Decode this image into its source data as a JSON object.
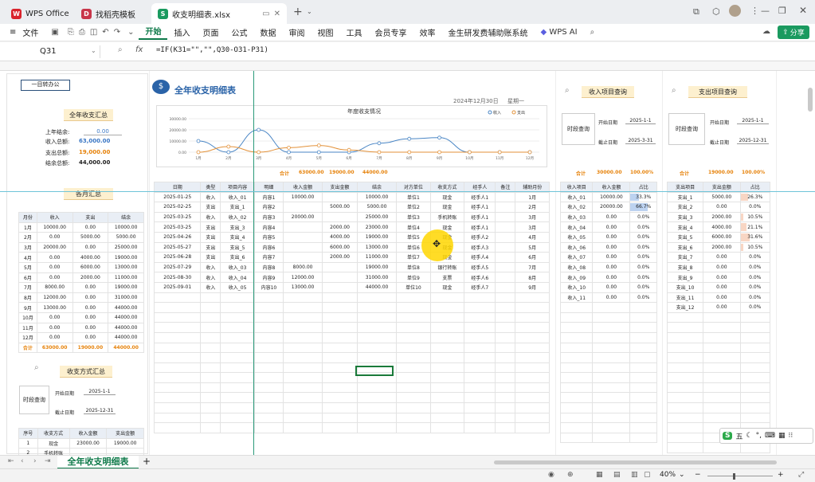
{
  "tabs": [
    {
      "label": "WPS Office"
    },
    {
      "label": "找稻壳模板"
    },
    {
      "label": "收支明细表.xlsx"
    }
  ],
  "menu": {
    "file": "文件",
    "items": [
      "开始",
      "插入",
      "页面",
      "公式",
      "数据",
      "审阅",
      "视图",
      "工具",
      "会员专享",
      "效率",
      "金生研发费辅助账系统"
    ],
    "wps_ai": "WPS AI",
    "share": "分享"
  },
  "formula_bar": {
    "cell_ref": "Q31",
    "fx": "fx",
    "formula": "=IF(K31=\"\",\"\",Q30-O31-P31)"
  },
  "left_panel": {
    "button": "一目转办公",
    "annual_title": "全年收支汇总",
    "summary": [
      {
        "label": "上年结余:",
        "value": "0.00"
      },
      {
        "label": "收入总额:",
        "value": "63,000.00"
      },
      {
        "label": "支出总额:",
        "value": "19,000.00"
      },
      {
        "label": "结余总额:",
        "value": "44,000.00"
      }
    ],
    "monthly_title": "各月汇总",
    "monthly_headers": [
      "月份",
      "收入",
      "支出",
      "结余"
    ],
    "monthly_rows": [
      [
        "1月",
        "10000.00",
        "0.00",
        "10000.00"
      ],
      [
        "2月",
        "0.00",
        "5000.00",
        "5000.00"
      ],
      [
        "3月",
        "20000.00",
        "0.00",
        "25000.00"
      ],
      [
        "4月",
        "0.00",
        "4000.00",
        "19000.00"
      ],
      [
        "5月",
        "0.00",
        "6000.00",
        "13000.00"
      ],
      [
        "6月",
        "0.00",
        "2000.00",
        "11000.00"
      ],
      [
        "7月",
        "8000.00",
        "0.00",
        "19000.00"
      ],
      [
        "8月",
        "12000.00",
        "0.00",
        "31000.00"
      ],
      [
        "9月",
        "13000.00",
        "0.00",
        "44000.00"
      ],
      [
        "10月",
        "0.00",
        "0.00",
        "44000.00"
      ],
      [
        "11月",
        "0.00",
        "0.00",
        "44000.00"
      ],
      [
        "12月",
        "0.00",
        "0.00",
        "44000.00"
      ]
    ],
    "monthly_total": [
      "合计",
      "63000.00",
      "19000.00",
      "44000.00"
    ],
    "method_title": "收支方式汇总",
    "period_query": "时段查询",
    "start_label": "开始日期",
    "start_value": "2025-1-1",
    "end_label": "截止日期",
    "end_value": "2025-12-31",
    "method_headers": [
      "序号",
      "收支方式",
      "收入金额",
      "支出金额"
    ],
    "method_rows": [
      [
        "1",
        "现金",
        "23000.00",
        "19000.00"
      ],
      [
        "2",
        "手机转账",
        "",
        ""
      ]
    ]
  },
  "main": {
    "title": "全年收支明细表",
    "date": "2024年12月30日",
    "weekday": "星期一",
    "chart_title": "年度收支情况",
    "totals_row": {
      "label": "合计",
      "income": "63000.00",
      "expense": "19000.00",
      "balance": "44000.00"
    },
    "headers": [
      "日期",
      "类型",
      "项目内容",
      "明细",
      "收入金额",
      "支出金额",
      "结余",
      "对方单位",
      "收支方式",
      "经手人",
      "备注",
      "辅助月份"
    ],
    "rows": [
      [
        "2025-01-25",
        "收入",
        "收入_01",
        "内容1",
        "10000.00",
        "",
        "10000.00",
        "单位1",
        "现金",
        "经手人1",
        "",
        "1月"
      ],
      [
        "2025-02-25",
        "支出",
        "支出_1",
        "内容2",
        "",
        "5000.00",
        "5000.00",
        "单位2",
        "现金",
        "经手人1",
        "",
        "2月"
      ],
      [
        "2025-03-25",
        "收入",
        "收入_02",
        "内容3",
        "20000.00",
        "",
        "25000.00",
        "单位3",
        "手机转账",
        "经手人1",
        "",
        "3月"
      ],
      [
        "2025-03-25",
        "支出",
        "支出_3",
        "内容4",
        "",
        "2000.00",
        "23000.00",
        "单位4",
        "现金",
        "经手人1",
        "",
        "3月"
      ],
      [
        "2025-04-26",
        "支出",
        "支出_4",
        "内容5",
        "",
        "4000.00",
        "19000.00",
        "单位5",
        "现金",
        "经手人2",
        "",
        "4月"
      ],
      [
        "2025-05-27",
        "支出",
        "支出_5",
        "内容6",
        "",
        "6000.00",
        "13000.00",
        "单位6",
        "现金",
        "经手人3",
        "",
        "5月"
      ],
      [
        "2025-06-28",
        "支出",
        "支出_6",
        "内容7",
        "",
        "2000.00",
        "11000.00",
        "单位7",
        "现金",
        "经手人4",
        "",
        "6月"
      ],
      [
        "2025-07-29",
        "收入",
        "收入_03",
        "内容8",
        "8000.00",
        "",
        "19000.00",
        "单位8",
        "银行转账",
        "经手人5",
        "",
        "7月"
      ],
      [
        "2025-08-30",
        "收入",
        "收入_04",
        "内容9",
        "12000.00",
        "",
        "31000.00",
        "单位9",
        "支票",
        "经手人6",
        "",
        "8月"
      ],
      [
        "2025-09-01",
        "收入",
        "收入_05",
        "内容10",
        "13000.00",
        "",
        "44000.00",
        "单位10",
        "现金",
        "经手人7",
        "",
        "9月"
      ]
    ]
  },
  "chart_data": {
    "type": "line",
    "title": "年度收支情况",
    "categories": [
      "1月",
      "2月",
      "3月",
      "4月",
      "5月",
      "6月",
      "7月",
      "8月",
      "9月",
      "10月",
      "11月",
      "12月"
    ],
    "series": [
      {
        "name": "收入",
        "color": "#4a86c5",
        "values": [
          10000,
          0,
          20000,
          0,
          0,
          0,
          8000,
          12000,
          13000,
          0,
          0,
          0
        ]
      },
      {
        "name": "支出",
        "color": "#e3923a",
        "values": [
          0,
          5000,
          0,
          4000,
          6000,
          2000,
          0,
          0,
          0,
          0,
          0,
          0
        ]
      }
    ],
    "y_ticks": [
      "30000.00",
      "20000.00",
      "10000.00",
      "0.00"
    ],
    "ylim": [
      0,
      30000
    ],
    "legend": "top-right"
  },
  "income_panel": {
    "title": "收入项目查询",
    "period_query": "时段查询",
    "start_label": "开始日期",
    "start_value": "2025-1-1",
    "end_label": "截止日期",
    "end_value": "2025-3-31",
    "total_label": "合计",
    "total_value": "30000.00",
    "total_pct": "100.00%",
    "headers": [
      "收入项目",
      "收入金额",
      "占比"
    ],
    "rows": [
      {
        "name": "收入_01",
        "amount": "10000.00",
        "pct": "33.3%",
        "ratio": 0.333
      },
      {
        "name": "收入_02",
        "amount": "20000.00",
        "pct": "66.7%",
        "ratio": 0.667
      },
      {
        "name": "收入_03",
        "amount": "0.00",
        "pct": "0.0%",
        "ratio": 0
      },
      {
        "name": "收入_04",
        "amount": "0.00",
        "pct": "0.0%",
        "ratio": 0
      },
      {
        "name": "收入_05",
        "amount": "0.00",
        "pct": "0.0%",
        "ratio": 0
      },
      {
        "name": "收入_06",
        "amount": "0.00",
        "pct": "0.0%",
        "ratio": 0
      },
      {
        "name": "收入_07",
        "amount": "0.00",
        "pct": "0.0%",
        "ratio": 0
      },
      {
        "name": "收入_08",
        "amount": "0.00",
        "pct": "0.0%",
        "ratio": 0
      },
      {
        "name": "收入_09",
        "amount": "0.00",
        "pct": "0.0%",
        "ratio": 0
      },
      {
        "name": "收入_10",
        "amount": "0.00",
        "pct": "0.0%",
        "ratio": 0
      },
      {
        "name": "收入_11",
        "amount": "0.00",
        "pct": "0.0%",
        "ratio": 0
      }
    ]
  },
  "expense_panel": {
    "title": "支出项目查询",
    "period_query": "时段查询",
    "start_label": "开始日期",
    "start_value": "2025-1-1",
    "end_label": "截止日期",
    "end_value": "2025-12-31",
    "total_label": "合计",
    "total_value": "19000.00",
    "total_pct": "100.00%",
    "headers": [
      "支出项目",
      "支出金额",
      "占比"
    ],
    "rows": [
      {
        "name": "支出_1",
        "amount": "5000.00",
        "pct": "26.3%",
        "ratio": 0.263
      },
      {
        "name": "支出_2",
        "amount": "0.00",
        "pct": "0.0%",
        "ratio": 0
      },
      {
        "name": "支出_3",
        "amount": "2000.00",
        "pct": "10.5%",
        "ratio": 0.105
      },
      {
        "name": "支出_4",
        "amount": "4000.00",
        "pct": "21.1%",
        "ratio": 0.211
      },
      {
        "name": "支出_5",
        "amount": "6000.00",
        "pct": "31.6%",
        "ratio": 0.316
      },
      {
        "name": "支出_6",
        "amount": "2000.00",
        "pct": "10.5%",
        "ratio": 0.105
      },
      {
        "name": "支出_7",
        "amount": "0.00",
        "pct": "0.0%",
        "ratio": 0
      },
      {
        "name": "支出_8",
        "amount": "0.00",
        "pct": "0.0%",
        "ratio": 0
      },
      {
        "name": "支出_9",
        "amount": "0.00",
        "pct": "0.0%",
        "ratio": 0
      },
      {
        "name": "支出_10",
        "amount": "0.00",
        "pct": "0.0%",
        "ratio": 0
      },
      {
        "name": "支出_11",
        "amount": "0.00",
        "pct": "0.0%",
        "ratio": 0
      },
      {
        "name": "支出_12",
        "amount": "0.00",
        "pct": "0.0%",
        "ratio": 0
      }
    ]
  },
  "bottom": {
    "sheet_tab": "全年收支明细表",
    "add": "+",
    "zoom": "40%",
    "ime": "五"
  }
}
